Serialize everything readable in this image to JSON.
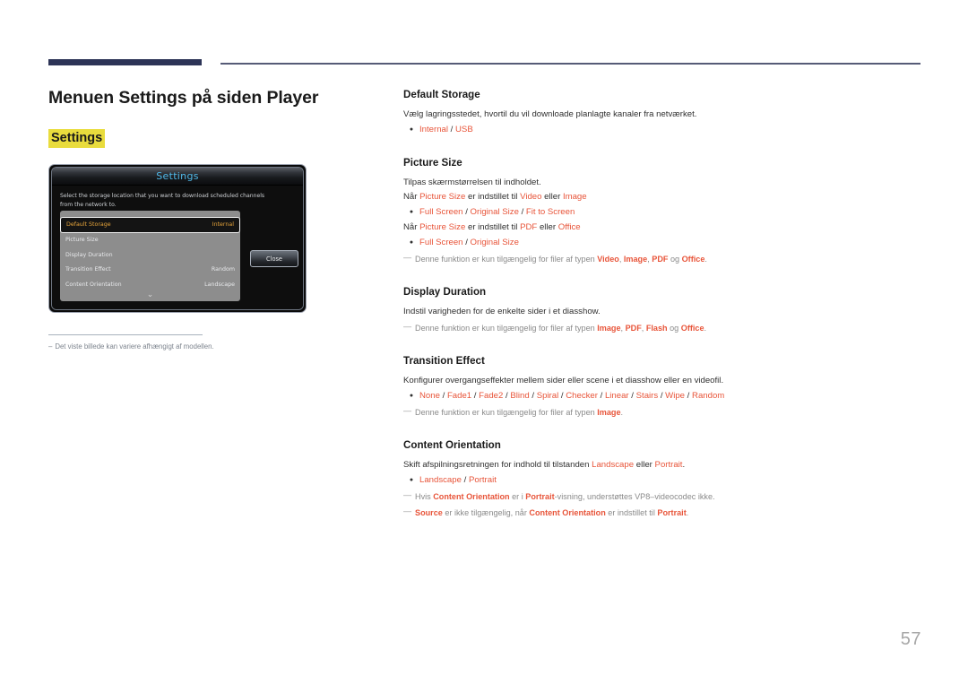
{
  "header": {
    "rule_color_thick": "#2d3457",
    "rule_color_thin": "#565b77"
  },
  "left": {
    "page_title": "Menuen Settings på siden Player",
    "settings_tag": "Settings",
    "caption": {
      "dash": "–",
      "text": "Det viste billede kan variere afhængigt af modellen."
    },
    "tv_dialog": {
      "title": "Settings",
      "description": "Select the storage location that you want to download scheduled channels from the network to.",
      "close_label": "Close",
      "chevron": "⌄",
      "rows": [
        {
          "label": "Default Storage",
          "value": "Internal",
          "selected": true
        },
        {
          "label": "Picture Size",
          "value": "",
          "selected": false
        },
        {
          "label": "Display Duration",
          "value": "",
          "selected": false
        },
        {
          "label": "Transition Effect",
          "value": "Random",
          "selected": false
        },
        {
          "label": "Content Orientation",
          "value": "Landscape",
          "selected": false
        }
      ]
    }
  },
  "right": {
    "sections": [
      {
        "id": "default-storage",
        "title": "Default Storage",
        "lines": [
          {
            "type": "para",
            "parts": [
              {
                "t": "Vælg lagringsstedet, hvortil du vil downloade planlagte kanaler fra netværket.",
                "s": "plain"
              }
            ]
          },
          {
            "type": "bullet",
            "parts": [
              {
                "t": "Internal",
                "s": "hl"
              },
              {
                "t": " / ",
                "s": "sep"
              },
              {
                "t": "USB",
                "s": "hl"
              }
            ]
          }
        ]
      },
      {
        "id": "picture-size",
        "title": "Picture Size",
        "lines": [
          {
            "type": "para",
            "parts": [
              {
                "t": "Tilpas skærmstørrelsen til indholdet.",
                "s": "plain"
              }
            ]
          },
          {
            "type": "para",
            "parts": [
              {
                "t": "Når ",
                "s": "plain"
              },
              {
                "t": "Picture Size",
                "s": "hl"
              },
              {
                "t": " er indstillet til ",
                "s": "plain"
              },
              {
                "t": "Video",
                "s": "hl"
              },
              {
                "t": " eller ",
                "s": "plain"
              },
              {
                "t": "Image",
                "s": "hl"
              }
            ]
          },
          {
            "type": "bullet",
            "parts": [
              {
                "t": "Full Screen",
                "s": "hl"
              },
              {
                "t": " / ",
                "s": "sep"
              },
              {
                "t": "Original Size",
                "s": "hl"
              },
              {
                "t": " / ",
                "s": "sep"
              },
              {
                "t": "Fit to Screen",
                "s": "hl"
              }
            ]
          },
          {
            "type": "para",
            "parts": [
              {
                "t": "Når ",
                "s": "plain"
              },
              {
                "t": "Picture Size",
                "s": "hl"
              },
              {
                "t": " er indstillet til ",
                "s": "plain"
              },
              {
                "t": "PDF",
                "s": "hl"
              },
              {
                "t": " eller ",
                "s": "plain"
              },
              {
                "t": "Office",
                "s": "hl"
              }
            ]
          },
          {
            "type": "bullet",
            "parts": [
              {
                "t": "Full Screen",
                "s": "hl"
              },
              {
                "t": " / ",
                "s": "sep"
              },
              {
                "t": "Original Size",
                "s": "hl"
              }
            ]
          },
          {
            "type": "note",
            "parts": [
              {
                "t": "Denne funktion er kun tilgængelig for filer af typen ",
                "s": "note"
              },
              {
                "t": "Video",
                "s": "hlb"
              },
              {
                "t": ", ",
                "s": "note"
              },
              {
                "t": "Image",
                "s": "hlb"
              },
              {
                "t": ", ",
                "s": "note"
              },
              {
                "t": "PDF",
                "s": "hlb"
              },
              {
                "t": " og ",
                "s": "note"
              },
              {
                "t": "Office",
                "s": "hlb"
              },
              {
                "t": ".",
                "s": "note"
              }
            ]
          }
        ]
      },
      {
        "id": "display-duration",
        "title": "Display Duration",
        "lines": [
          {
            "type": "para",
            "parts": [
              {
                "t": "Indstil varigheden for de enkelte sider i et diasshow.",
                "s": "plain"
              }
            ]
          },
          {
            "type": "note",
            "parts": [
              {
                "t": "Denne funktion er kun tilgængelig for filer af typen ",
                "s": "note"
              },
              {
                "t": "Image",
                "s": "hlb"
              },
              {
                "t": ", ",
                "s": "note"
              },
              {
                "t": "PDF",
                "s": "hlb"
              },
              {
                "t": ", ",
                "s": "note"
              },
              {
                "t": "Flash",
                "s": "hlb"
              },
              {
                "t": " og ",
                "s": "note"
              },
              {
                "t": "Office",
                "s": "hlb"
              },
              {
                "t": ".",
                "s": "note"
              }
            ]
          }
        ]
      },
      {
        "id": "transition-effect",
        "title": "Transition Effect",
        "lines": [
          {
            "type": "para",
            "parts": [
              {
                "t": "Konfigurer overgangseffekter mellem sider eller scene i et diasshow eller en videofil.",
                "s": "plain"
              }
            ]
          },
          {
            "type": "bullet",
            "parts": [
              {
                "t": "None",
                "s": "hl"
              },
              {
                "t": " / ",
                "s": "sep"
              },
              {
                "t": "Fade1",
                "s": "hl"
              },
              {
                "t": " / ",
                "s": "sep"
              },
              {
                "t": "Fade2",
                "s": "hl"
              },
              {
                "t": " / ",
                "s": "sep"
              },
              {
                "t": "Blind",
                "s": "hl"
              },
              {
                "t": " / ",
                "s": "sep"
              },
              {
                "t": "Spiral",
                "s": "hl"
              },
              {
                "t": " / ",
                "s": "sep"
              },
              {
                "t": "Checker",
                "s": "hl"
              },
              {
                "t": " / ",
                "s": "sep"
              },
              {
                "t": "Linear",
                "s": "hl"
              },
              {
                "t": " / ",
                "s": "sep"
              },
              {
                "t": "Stairs",
                "s": "hl"
              },
              {
                "t": " / ",
                "s": "sep"
              },
              {
                "t": "Wipe",
                "s": "hl"
              },
              {
                "t": " / ",
                "s": "sep"
              },
              {
                "t": "Random",
                "s": "hl"
              }
            ]
          },
          {
            "type": "note",
            "parts": [
              {
                "t": "Denne funktion er kun tilgængelig for filer af typen ",
                "s": "note"
              },
              {
                "t": "Image",
                "s": "hlb"
              },
              {
                "t": ".",
                "s": "note"
              }
            ]
          }
        ]
      },
      {
        "id": "content-orientation",
        "title": "Content Orientation",
        "lines": [
          {
            "type": "para",
            "parts": [
              {
                "t": "Skift afspilningsretningen for indhold til tilstanden ",
                "s": "plain"
              },
              {
                "t": "Landscape",
                "s": "hl"
              },
              {
                "t": " eller ",
                "s": "plain"
              },
              {
                "t": "Portrait",
                "s": "hl"
              },
              {
                "t": ".",
                "s": "plain"
              }
            ]
          },
          {
            "type": "bullet",
            "parts": [
              {
                "t": "Landscape",
                "s": "hl"
              },
              {
                "t": " / ",
                "s": "sep"
              },
              {
                "t": "Portrait",
                "s": "hl"
              }
            ]
          },
          {
            "type": "note",
            "parts": [
              {
                "t": "Hvis ",
                "s": "note"
              },
              {
                "t": "Content Orientation",
                "s": "hlb"
              },
              {
                "t": " er i ",
                "s": "note"
              },
              {
                "t": "Portrait",
                "s": "hlb"
              },
              {
                "t": "-visning, understøttes VP8–videocodec ikke.",
                "s": "note"
              }
            ]
          },
          {
            "type": "note",
            "parts": [
              {
                "t": "Source",
                "s": "hlb"
              },
              {
                "t": " er ikke tilgængelig, når ",
                "s": "note"
              },
              {
                "t": "Content Orientation",
                "s": "hlb"
              },
              {
                "t": " er indstillet til ",
                "s": "note"
              },
              {
                "t": "Portrait",
                "s": "hlb"
              },
              {
                "t": ".",
                "s": "note"
              }
            ]
          }
        ]
      }
    ],
    "note_dash": "—",
    "bullet_glyph": "●"
  },
  "footer": {
    "page_number": "57"
  }
}
